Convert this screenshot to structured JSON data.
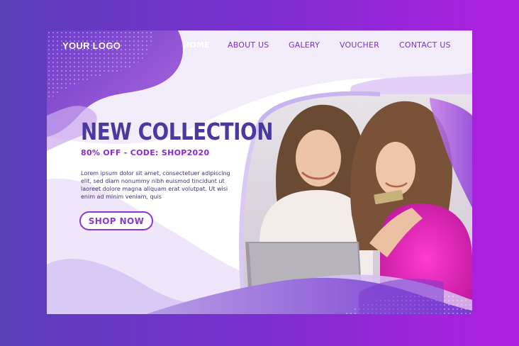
{
  "logo": {
    "text": "YOUR LOGO"
  },
  "nav": {
    "items": [
      {
        "label": "HOME",
        "active": true
      },
      {
        "label": "ABOUT US",
        "active": false
      },
      {
        "label": "GALERY",
        "active": false
      },
      {
        "label": "VOUCHER",
        "active": false
      },
      {
        "label": "CONTACT US",
        "active": false
      }
    ]
  },
  "hero": {
    "title": "NEW COLLECTION",
    "promo": "80% OFF - CODE: SHOP2020",
    "body": "Lorem ipsum dolor sit amet, consectetuer adipiscing elit, sed diam nonummy nibh euismod tincidunt ut laoreet dolore magna aliquam erat volutpat. Ut wisi enim ad minim veniam, quis",
    "cta_label": "SHOP NOW"
  },
  "colors": {
    "brand_purple": "#7a32c8",
    "title_indigo": "#4a3aa0",
    "accent_magenta": "#d83ad8"
  }
}
